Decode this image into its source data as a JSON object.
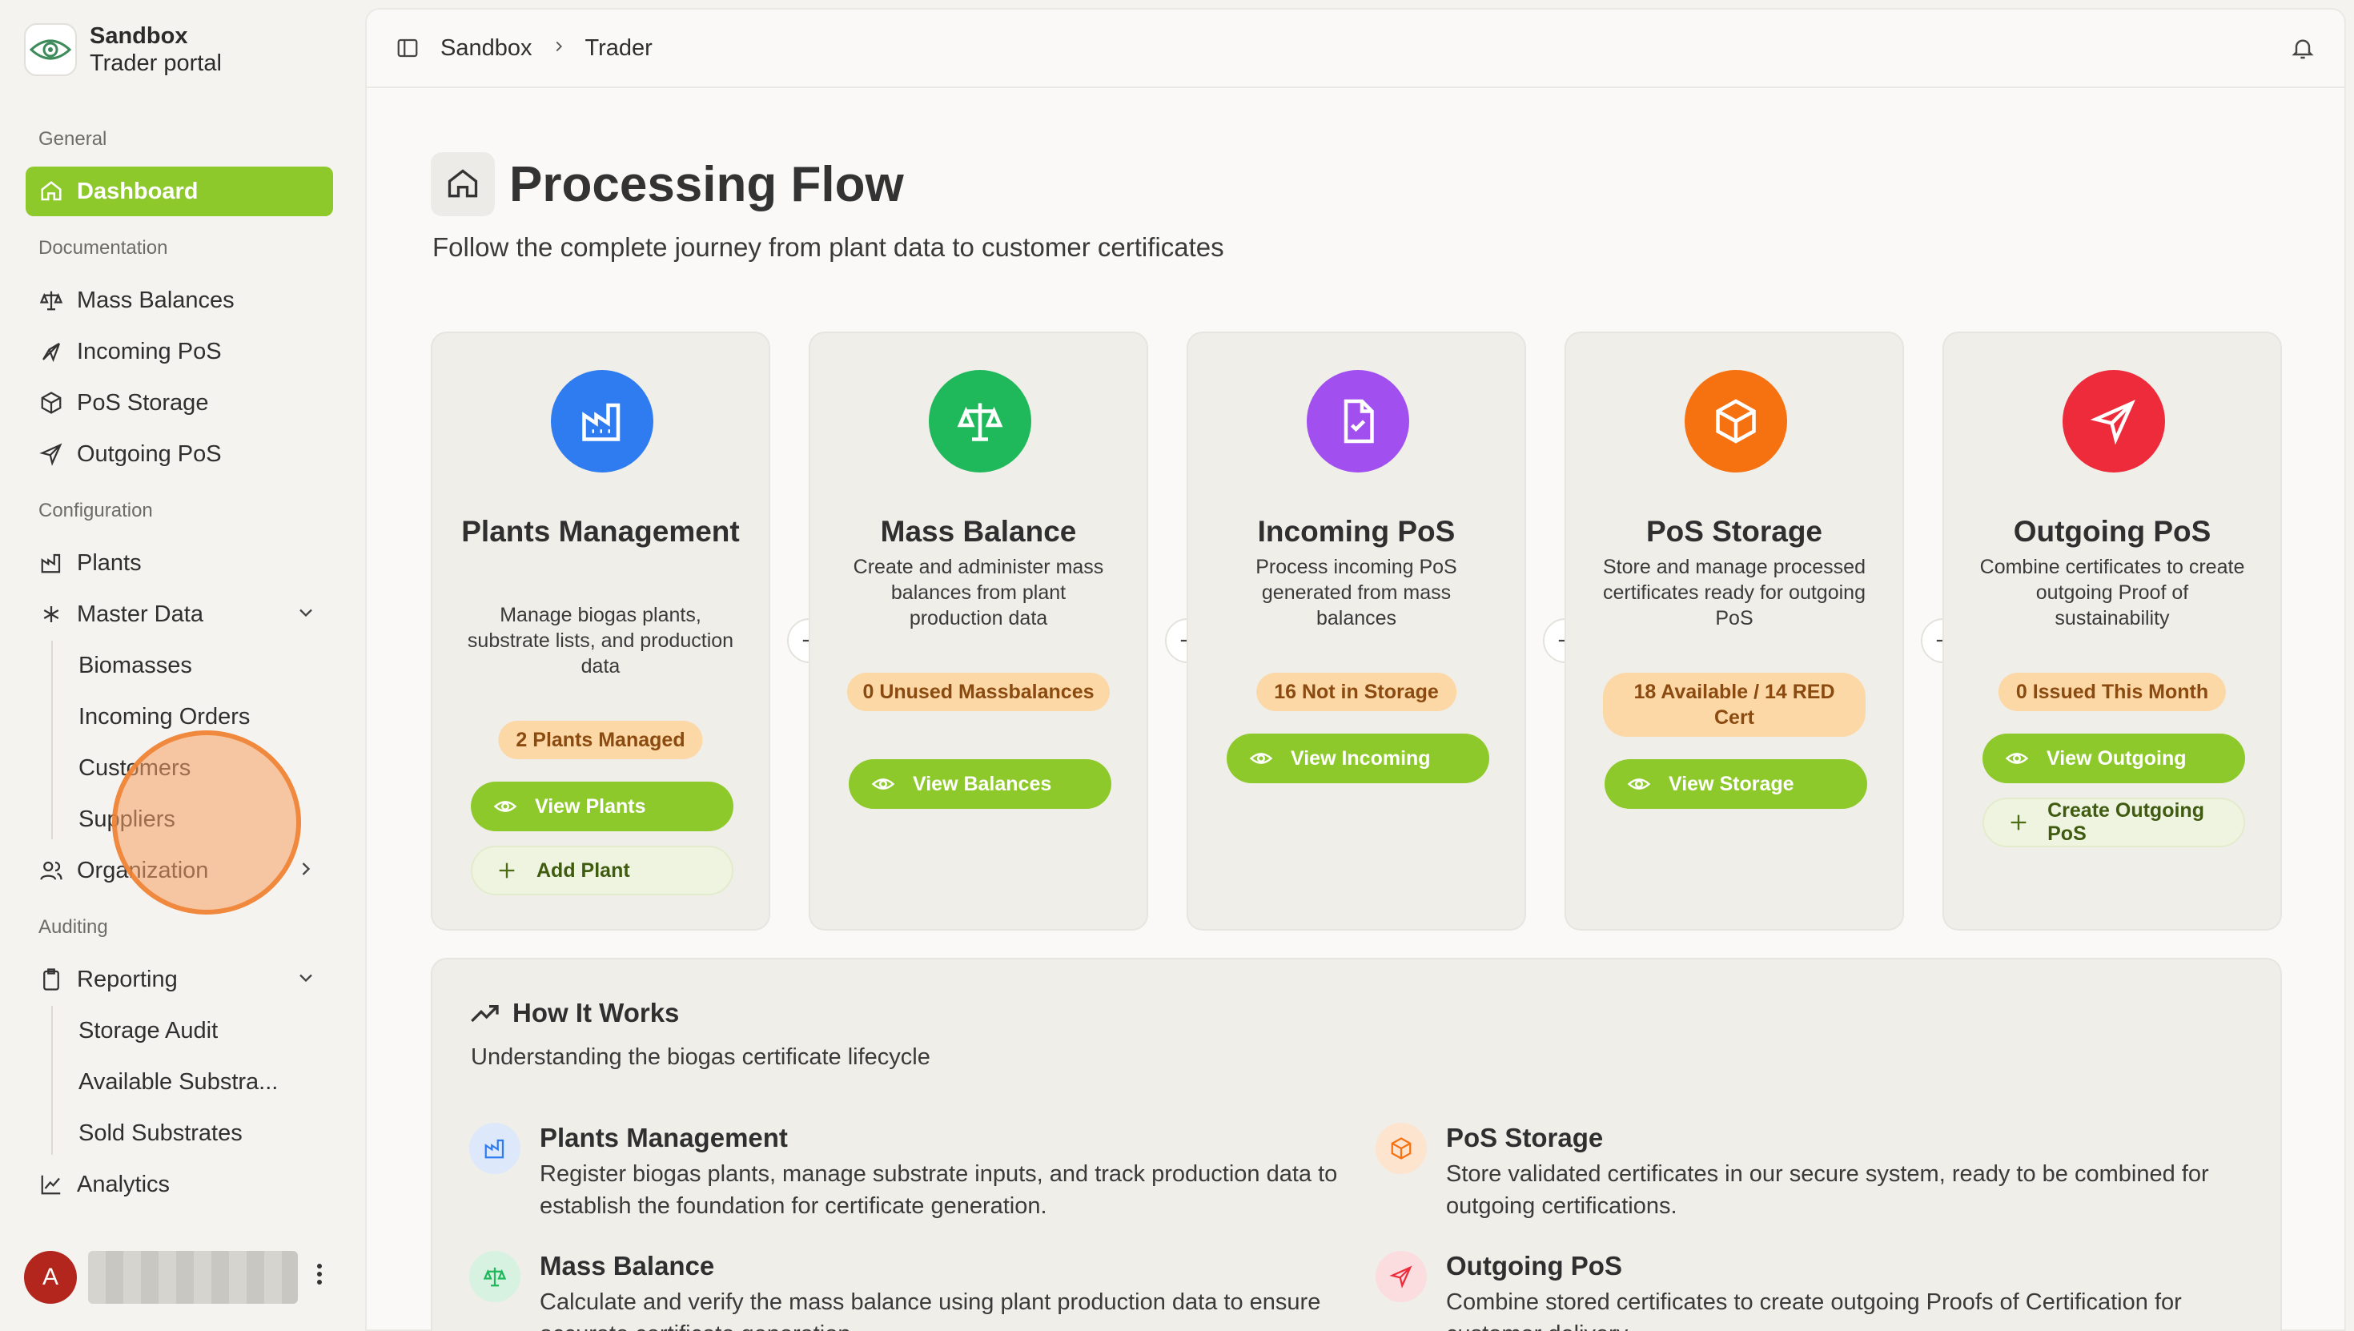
{
  "brand": {
    "name": "Sandbox",
    "subtitle": "Trader portal"
  },
  "sidebar": {
    "sections": {
      "general": "General",
      "documentation": "Documentation",
      "configuration": "Configuration",
      "auditing": "Auditing"
    },
    "items": {
      "dashboard": "Dashboard",
      "mass_balances": "Mass Balances",
      "incoming_pos": "Incoming PoS",
      "pos_storage": "PoS Storage",
      "outgoing_pos": "Outgoing PoS",
      "plants": "Plants",
      "master_data": "Master Data",
      "biomasses": "Biomasses",
      "incoming_orders": "Incoming Orders",
      "customers": "Customers",
      "suppliers": "Suppliers",
      "organization": "Organization",
      "reporting": "Reporting",
      "storage_audit": "Storage Audit",
      "available_substrates": "Available Substra...",
      "sold_substrates": "Sold Substrates",
      "analytics": "Analytics"
    },
    "user": {
      "avatar_letter": "A"
    }
  },
  "breadcrumb": {
    "root": "Sandbox",
    "current": "Trader"
  },
  "page": {
    "title": "Processing Flow",
    "subtitle": "Follow the complete journey from plant data to customer certificates"
  },
  "cards": [
    {
      "title": "Plants Management",
      "description": "Manage biogas plants, substrate lists, and production data",
      "badge": "2 Plants Managed",
      "primary": "View Plants",
      "secondary": "Add Plant",
      "color": "#2f7cf0",
      "icon": "factory-icon"
    },
    {
      "title": "Mass Balance",
      "description": "Create and administer mass balances from plant production data",
      "badge": "0 Unused Massbalances",
      "primary": "View Balances",
      "color": "#1fb85a",
      "icon": "scale-icon"
    },
    {
      "title": "Incoming PoS",
      "description": "Process incoming PoS generated from mass balances",
      "badge": "16 Not in Storage",
      "primary": "View Incoming",
      "color": "#a24ff0",
      "icon": "document-check-icon"
    },
    {
      "title": "PoS Storage",
      "description": "Store and manage processed certificates ready for outgoing PoS",
      "badge": "18 Available / 14 RED Cert",
      "primary": "View Storage",
      "color": "#f6710f",
      "icon": "package-icon"
    },
    {
      "title": "Outgoing PoS",
      "description": "Combine certificates to create outgoing Proof of sustainability",
      "badge": "0 Issued This Month",
      "primary": "View Outgoing",
      "secondary": "Create Outgoing PoS",
      "color": "#ee2b3b",
      "icon": "send-icon"
    }
  ],
  "how": {
    "title": "How It Works",
    "subtitle": "Understanding the biogas certificate lifecycle",
    "steps": [
      {
        "title": "Plants Management",
        "description": "Register biogas plants, manage substrate inputs, and track production data to establish the foundation for certificate generation."
      },
      {
        "title": "PoS Storage",
        "description": "Store validated certificates in our secure system, ready to be combined for outgoing certifications."
      },
      {
        "title": "Mass Balance",
        "description": "Calculate and verify the mass balance using plant production data to ensure accurate certificate generation."
      },
      {
        "title": "Outgoing PoS",
        "description": "Combine stored certificates to create outgoing Proofs of Certification for customer delivery."
      }
    ]
  }
}
